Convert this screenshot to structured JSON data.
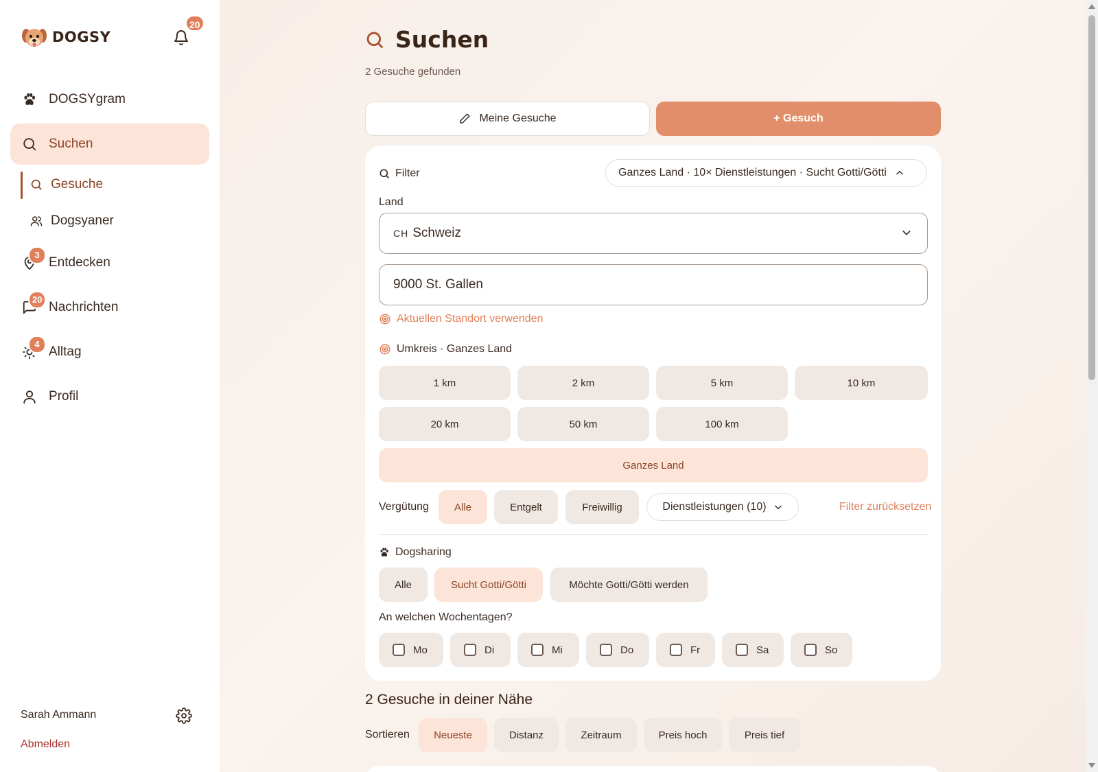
{
  "colors": {
    "accent": "#e38e6a",
    "accent_dark": "#8a4325",
    "selected_bg": "#fde4d8",
    "chip_bg": "#efe8e3",
    "link": "#e0805a",
    "logout": "#a8302d"
  },
  "sidebar": {
    "brand": "DOGSY",
    "notifications_count": "20",
    "items": [
      {
        "label": "DOGSYgram",
        "icon": "paw-icon",
        "badge": ""
      },
      {
        "label": "Suchen",
        "icon": "search-icon",
        "badge": ""
      },
      {
        "label": "Entdecken",
        "icon": "map-pin-icon",
        "badge": "3"
      },
      {
        "label": "Nachrichten",
        "icon": "chat-icon",
        "badge": "20"
      },
      {
        "label": "Alltag",
        "icon": "sun-icon",
        "badge": "4"
      },
      {
        "label": "Profil",
        "icon": "user-icon",
        "badge": ""
      }
    ],
    "subitems": [
      {
        "label": "Gesuche",
        "icon": "search-icon"
      },
      {
        "label": "Dogsyaner",
        "icon": "users-icon"
      }
    ],
    "user_name": "Sarah Ammann",
    "logout": "Abmelden"
  },
  "main": {
    "title": "Suchen",
    "found": "2 Gesuche gefunden",
    "my_requests": "Meine Gesuche",
    "new_request": "+ Gesuch",
    "filter": {
      "label": "Filter",
      "summary": "Ganzes Land · 10× Dienstleistungen · Sucht Gotti/Götti",
      "country_label": "Land",
      "country_code": "CH",
      "country": "Schweiz",
      "location": "9000 St. Gallen",
      "use_location": "Aktuellen Standort verwenden",
      "radius_label": "Umkreis · Ganzes Land",
      "radius_options": [
        "1 km",
        "2 km",
        "5 km",
        "10 km",
        "20 km",
        "50 km",
        "100 km"
      ],
      "radius_all": "Ganzes Land",
      "pay_label": "Vergütung",
      "pay_options": [
        "Alle",
        "Entgelt",
        "Freiwillig"
      ],
      "services": "Dienstleistungen (10)",
      "reset": "Filter zurücksetzen",
      "sharing_label": "Dogsharing",
      "sharing_options": [
        "Alle",
        "Sucht Gotti/Götti",
        "Möchte Gotti/Götti werden"
      ],
      "weekdays_label": "An welchen Wochentagen?",
      "weekdays": [
        "Mo",
        "Di",
        "Mi",
        "Do",
        "Fr",
        "Sa",
        "So"
      ]
    },
    "nearby_title": "2 Gesuche in deiner Nähe",
    "sort_label": "Sortieren",
    "sort_options": [
      "Neueste",
      "Distanz",
      "Zeitraum",
      "Preis hoch",
      "Preis tief"
    ]
  }
}
